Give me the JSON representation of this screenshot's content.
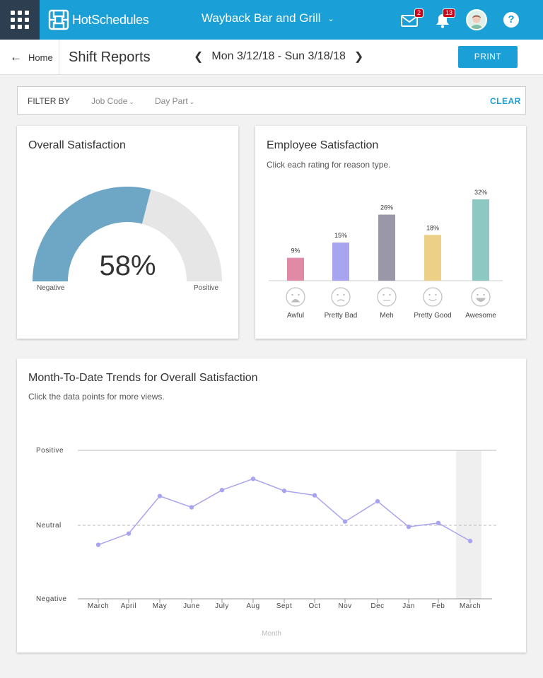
{
  "app": {
    "brand": "HotSchedules",
    "location": "Wayback Bar and Grill",
    "messages_badge": "2",
    "notifications_badge": "13",
    "help_label": "?"
  },
  "subheader": {
    "home_label": "Home",
    "page_title": "Shift Reports",
    "date_range": "Mon 3/12/18 - Sun 3/18/18",
    "print_label": "PRINT"
  },
  "filter": {
    "label": "FILTER BY",
    "job_code": "Job Code",
    "day_part": "Day Part",
    "clear": "CLEAR"
  },
  "overall": {
    "title": "Overall Satisfaction",
    "value_text": "58%",
    "value": 58,
    "left_label": "Negative",
    "right_label": "Positive",
    "colors": {
      "fill": "#6ea7c6",
      "track": "#e6e6e6"
    }
  },
  "employee": {
    "title": "Employee Satisfaction",
    "subtitle": "Click each rating for reason type."
  },
  "trends": {
    "title": "Month-To-Date Trends for Overall Satisfaction",
    "subtitle": "Click the data points for more views."
  },
  "chart_data": [
    {
      "type": "bar",
      "categories": [
        "Awful",
        "Pretty Bad",
        "Meh",
        "Pretty Good",
        "Awesome"
      ],
      "values": [
        9,
        15,
        26,
        18,
        32
      ],
      "data_labels": [
        "9%",
        "15%",
        "26%",
        "18%",
        "32%"
      ],
      "colors": [
        "#e08aa5",
        "#a9a4ef",
        "#9a98a8",
        "#ecd088",
        "#8ec8c2"
      ],
      "icons": [
        "awful-face-icon",
        "pretty-bad-face-icon",
        "meh-face-icon",
        "pretty-good-face-icon",
        "awesome-face-icon"
      ],
      "ylim": [
        0,
        32
      ]
    },
    {
      "type": "line",
      "x": [
        "March",
        "April",
        "May",
        "June",
        "July",
        "Aug",
        "Sept",
        "Oct",
        "Nov",
        "Dec",
        "Jan",
        "Feb",
        "March"
      ],
      "values": [
        -0.26,
        -0.11,
        0.39,
        0.24,
        0.47,
        0.62,
        0.46,
        0.4,
        0.05,
        0.32,
        -0.02,
        0.03,
        -0.21
      ],
      "y_tick_labels": [
        "Positive",
        "Neutral",
        "Negative"
      ],
      "ylim": [
        -1,
        1
      ],
      "xlabel": "Month",
      "highlighted_index": 12,
      "color": "#a9a4ef",
      "grid": false
    }
  ]
}
